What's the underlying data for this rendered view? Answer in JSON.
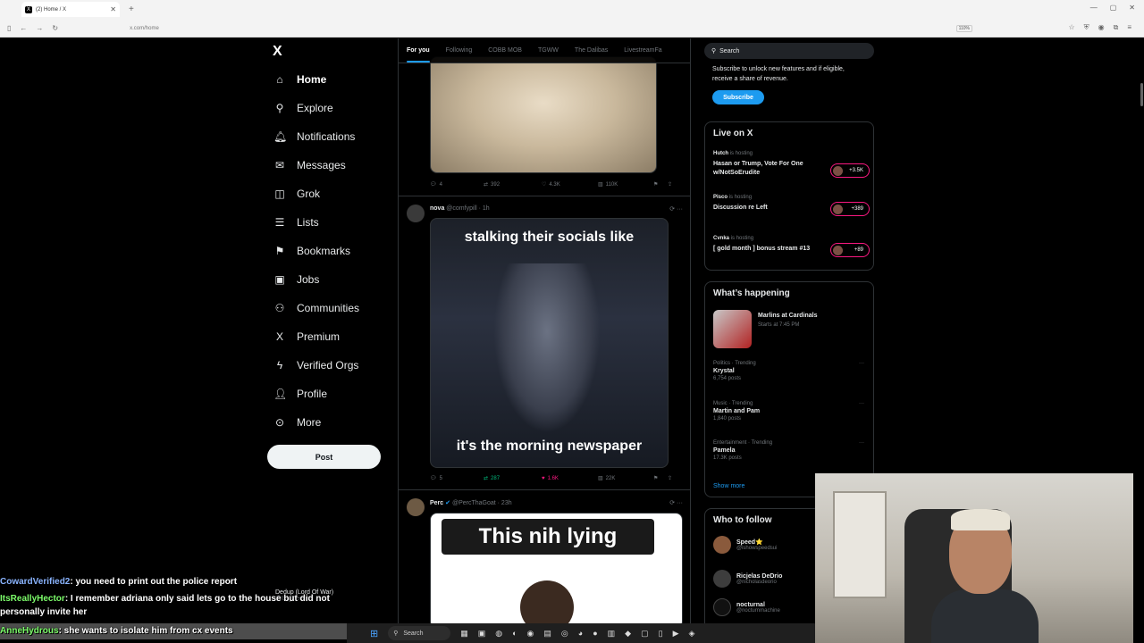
{
  "browser": {
    "tab_title": "(2) Home / X",
    "url": "x.com/home",
    "zoom": "110%",
    "new_tab": "+",
    "tab_close": "✕"
  },
  "leftnav": {
    "items": [
      {
        "label": "Home",
        "icon": "home-icon",
        "glyph": "⌂"
      },
      {
        "label": "Explore",
        "icon": "search-icon",
        "glyph": "⚲"
      },
      {
        "label": "Notifications",
        "icon": "bell-icon",
        "glyph": "♫"
      },
      {
        "label": "Messages",
        "icon": "envelope-icon",
        "glyph": "✉"
      },
      {
        "label": "Grok",
        "icon": "grok-icon",
        "glyph": "◫"
      },
      {
        "label": "Lists",
        "icon": "list-icon",
        "glyph": "☰"
      },
      {
        "label": "Bookmarks",
        "icon": "bookmark-icon",
        "glyph": "⚑"
      },
      {
        "label": "Jobs",
        "icon": "briefcase-icon",
        "glyph": "▣"
      },
      {
        "label": "Communities",
        "icon": "people-icon",
        "glyph": "⚇"
      },
      {
        "label": "Premium",
        "icon": "x-logo-icon",
        "glyph": "𝕏"
      },
      {
        "label": "Verified Orgs",
        "icon": "lightning-icon",
        "glyph": "ϟ"
      },
      {
        "label": "Profile",
        "icon": "person-icon",
        "glyph": "☺"
      },
      {
        "label": "More",
        "icon": "more-circle-icon",
        "glyph": "⊙"
      }
    ],
    "post_button": "Post",
    "logo": "X"
  },
  "feed": {
    "tabs": [
      "For you",
      "Following",
      "COBB MOB",
      "TGWW",
      "The Dalibas",
      "LivestreamFa"
    ],
    "post0": {
      "replies": "4",
      "reposts": "392",
      "likes": "4.3K",
      "views": "110K"
    },
    "post1": {
      "name": "nova",
      "handle": "@comfypill · 1h",
      "caption_top": "stalking their socials like",
      "caption_bottom": "it's the morning newspaper",
      "replies": "5",
      "reposts": "287",
      "likes": "1.6K",
      "views": "22K"
    },
    "post2": {
      "name": "Perc",
      "handle": "@PercThaGoat · 23h",
      "banner": "This nih lying"
    }
  },
  "right": {
    "search_placeholder": "Search",
    "subscribe_text": "Subscribe to unlock new features and if eligible, receive a share of revenue.",
    "subscribe_button": "Subscribe",
    "live_title": "Live on X",
    "live": [
      {
        "host": "Hutch",
        "hosting": "is hosting",
        "title": "Hasan or Trump, Vote For One w/NotSoErudite",
        "count": "+3.5K"
      },
      {
        "host": "Pisco",
        "hosting": "is hosting",
        "title": "Discussion re Left",
        "count": "+389"
      },
      {
        "host": "Cvnka",
        "hosting": "is hosting",
        "title": "[ gold month ] bonus stream #13",
        "count": "+89"
      }
    ],
    "happening_title": "What’s happening",
    "happening_event": {
      "title": "Marlins at Cardinals",
      "time": "Starts at 7:45 PM"
    },
    "trends": [
      {
        "context": "Politics · Trending",
        "name": "Krystal",
        "posts": "6,754 posts"
      },
      {
        "context": "Music · Trending",
        "name": "Martin and Pam",
        "posts": "1,840 posts"
      },
      {
        "context": "Entertainment · Trending",
        "name": "Pamela",
        "posts": "17.3K posts"
      }
    ],
    "show_more": "Show more",
    "wtf_title": "Who to follow",
    "wtf": [
      {
        "name": "Speed⭐",
        "handle": "@ishowspeedsui"
      },
      {
        "name": "Ricjelas DeDrio",
        "handle": "@nicholasdeorio"
      },
      {
        "name": "nocturnal",
        "handle": "@nocturnmachine"
      }
    ]
  },
  "overlay": {
    "account_name": "Dedup (Lord Of War)",
    "account_handle": "@Ixl_Dedup",
    "chat": [
      {
        "user": "CowardVerified2",
        "msg": ": you need to print out the police report"
      },
      {
        "user": "ItsReallyHector",
        "msg": ": I remember adriana only said lets go to the house but did not personally invite her"
      },
      {
        "user": "AnneHydrous",
        "msg": ": she wants to isolate him from cx events"
      }
    ],
    "taskbar_search": "Search"
  }
}
